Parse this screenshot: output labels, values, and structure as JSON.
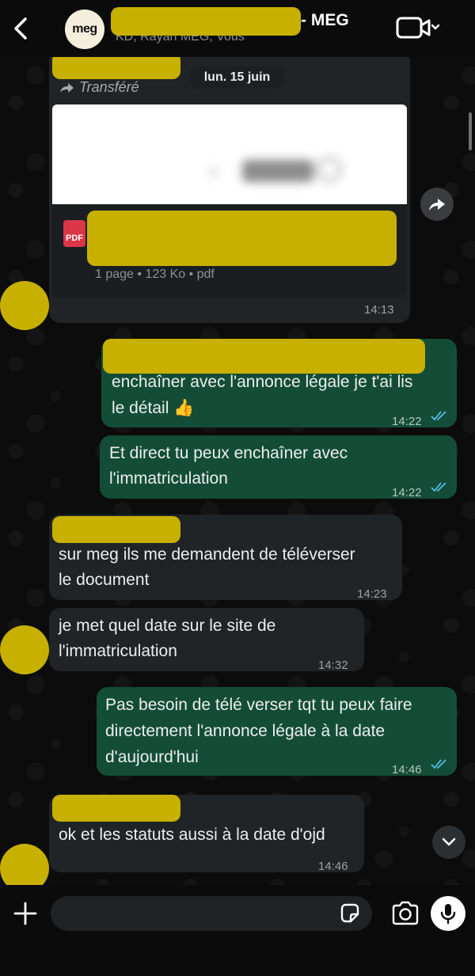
{
  "header": {
    "title_suffix": "- MEG",
    "subtitle": "KD, Rayan MEG, Vous",
    "avatar_text": "meg"
  },
  "date_separator": "lun. 15 juin",
  "messages": [
    {
      "direction": "incoming",
      "forwarded_label": "Transféré",
      "attachment": {
        "icon_label": "PDF",
        "meta": "1 page • 123 Ko • pdf"
      },
      "time": "14:13"
    },
    {
      "direction": "outgoing",
      "lines": [
        "enchaîner avec l'annonce légale je t'ai lis",
        "le détail 👍"
      ],
      "time": "14:22",
      "status": "read"
    },
    {
      "direction": "outgoing",
      "lines": [
        "Et direct tu peux enchaîner avec",
        "l'immatriculation"
      ],
      "time": "14:22",
      "status": "read"
    },
    {
      "direction": "incoming",
      "lines": [
        "sur meg ils me demandent de téléverser",
        "le document"
      ],
      "time": "14:23"
    },
    {
      "direction": "incoming",
      "lines": [
        "je met quel date sur le site de",
        "l'immatriculation"
      ],
      "time": "14:32"
    },
    {
      "direction": "outgoing",
      "lines": [
        "Pas besoin de télé verser tqt tu peux faire",
        "directement l'annonce légale à la date",
        "d'aujourd'hui"
      ],
      "time": "14:46",
      "status": "read"
    },
    {
      "direction": "incoming",
      "lines": [
        "ok et les statuts aussi à la date d'ojd"
      ],
      "time": "14:46"
    }
  ],
  "composer": {
    "placeholder": ""
  },
  "colors": {
    "incoming_bubble": "#202427",
    "outgoing_bubble": "#144d37",
    "redaction": "#c7b000",
    "read_ticks": "#53bdeb"
  },
  "icons": [
    "back-icon",
    "video-call-icon",
    "forward-icon",
    "pdf-icon",
    "share-icon",
    "chevron-down-icon",
    "plus-icon",
    "sticker-icon",
    "camera-icon",
    "microphone-icon"
  ]
}
